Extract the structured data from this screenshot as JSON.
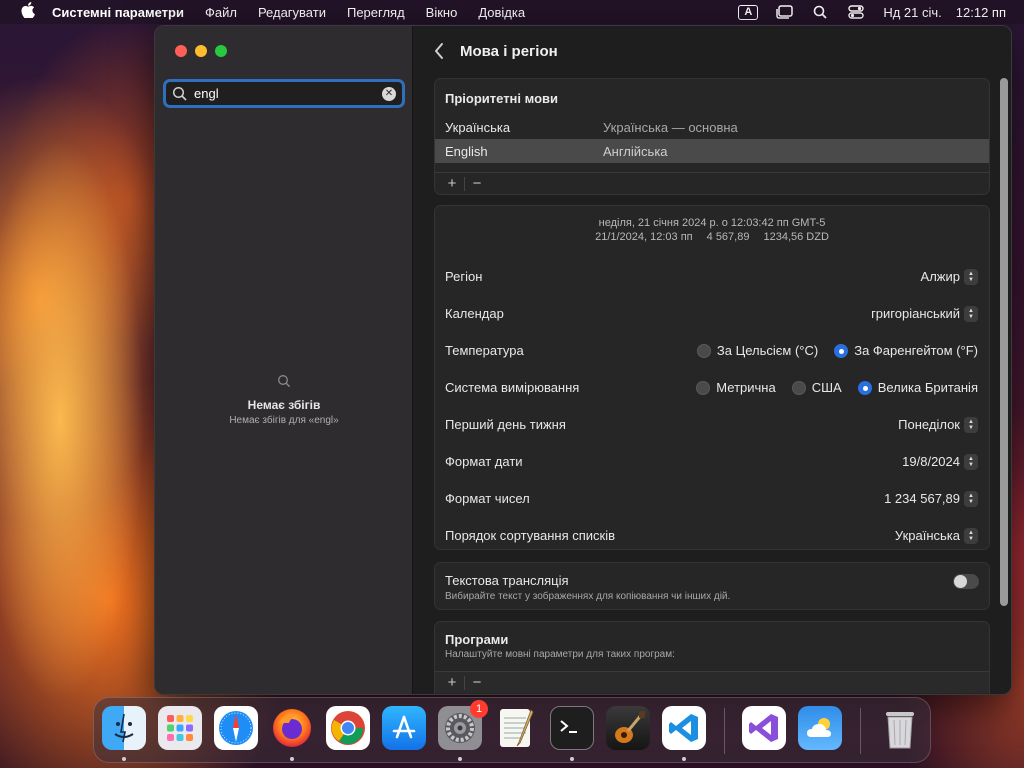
{
  "menubar": {
    "apple": "",
    "app": "Системні параметри",
    "items": [
      "Файл",
      "Редагувати",
      "Перегляд",
      "Вікно",
      "Довідка"
    ],
    "input_indicator": "A",
    "date": "Нд 21 січ.",
    "time": "12:12 пп"
  },
  "sidebar": {
    "search_value": "engl",
    "no_results_title": "Немає збігів",
    "no_results_sub": "Немає збігів для «engl»"
  },
  "main": {
    "title": "Мова і регіон",
    "preferred": {
      "heading": "Пріоритетні мови",
      "languages": [
        {
          "name": "Українська",
          "detail": "Українська — основна"
        },
        {
          "name": "English",
          "detail": "Англійська"
        }
      ],
      "add": "+",
      "remove": "−"
    },
    "preview": {
      "line1": "неділя, 21 січня 2024 р. о 12:03:42 пп GMT-5",
      "date": "21/1/2024, 12:03 пп",
      "num": "4 567,89",
      "currency": "1234,56 DZD"
    },
    "settings": {
      "region_label": "Регіон",
      "region_value": "Алжир",
      "calendar_label": "Календар",
      "calendar_value": "григоріанський",
      "temperature_label": "Температура",
      "temp_c": "За Цельсієм (°C)",
      "temp_f": "За Фаренгейтом (°F)",
      "measurement_label": "Система вимірювання",
      "meas_metric": "Метрична",
      "meas_us": "США",
      "meas_uk": "Велика Британія",
      "first_day_label": "Перший день тижня",
      "first_day_value": "Понеділок",
      "date_format_label": "Формат дати",
      "date_format_value": "19/8/2024",
      "number_format_label": "Формат чисел",
      "number_format_value": "1 234 567,89",
      "sort_label": "Порядок сортування списків",
      "sort_value": "Українська"
    },
    "live_text": {
      "title": "Текстова трансляція",
      "desc": "Вибирайте текст у зображеннях для копіювання чи інших дій."
    },
    "apps": {
      "title": "Програми",
      "desc": "Налаштуйте мовні параметри для таких програм:",
      "add": "+",
      "remove": "−"
    }
  },
  "dock": {
    "settings_badge": "1"
  }
}
